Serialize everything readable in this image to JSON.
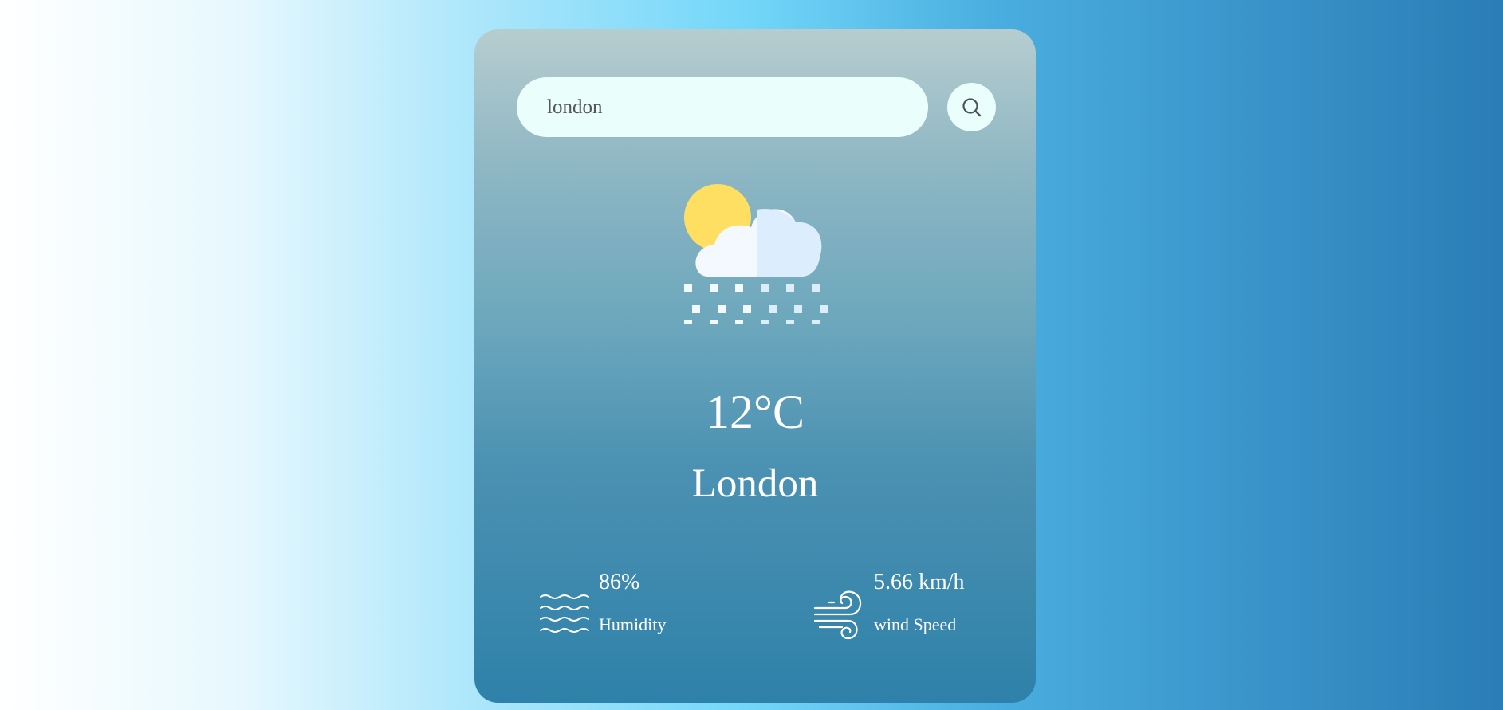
{
  "search": {
    "value": "london",
    "placeholder": ""
  },
  "weather": {
    "icon": "snow-cloud-sun-icon",
    "temperature": "12°C",
    "city": "London"
  },
  "details": {
    "humidity": {
      "icon": "humidity-waves-icon",
      "value": "86%",
      "label": "Humidity"
    },
    "wind": {
      "icon": "wind-icon",
      "value": "5.66 km/h",
      "label": "wind Speed"
    }
  },
  "colors": {
    "card_top": "#b6cdcf",
    "card_bottom": "#2e81aa",
    "search_bg": "#eafffb",
    "sun": "#ffdf61",
    "cloud_light": "#f3f9fe",
    "cloud_shade": "#dcedfe"
  }
}
